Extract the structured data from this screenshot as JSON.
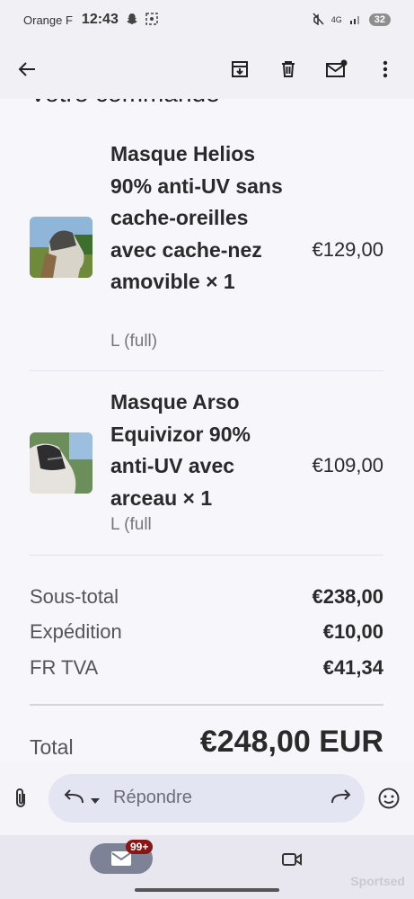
{
  "status_bar": {
    "carrier": "Orange F",
    "time": "12:43",
    "network": "4G",
    "battery": "32"
  },
  "toolbar": {
    "icons": [
      "back-arrow-icon",
      "archive-icon",
      "delete-icon",
      "mark-unread-icon",
      "more-icon"
    ]
  },
  "order": {
    "heading": "Votre commande",
    "items": [
      {
        "name": "Masque Helios 90% anti-UV sans cache-oreilles avec cache-nez amovible × 1",
        "variant": "L (full)",
        "price": "€129,00"
      },
      {
        "name": "Masque Arso Equivizor 90% anti-UV avec arceau × 1",
        "variant": "L (full",
        "price": "€109,00"
      }
    ],
    "subtotal_label": "Sous-total",
    "subtotal_value": "€238,00",
    "shipping_label": "Expédition",
    "shipping_value": "€10,00",
    "tax_label": "FR TVA",
    "tax_value": "€41,34",
    "total_label": "Total",
    "total_value": "€248,00 EUR"
  },
  "reply_bar": {
    "placeholder": "Répondre"
  },
  "bottom_nav": {
    "mail_badge": "99+"
  },
  "watermark": "Sportsed"
}
